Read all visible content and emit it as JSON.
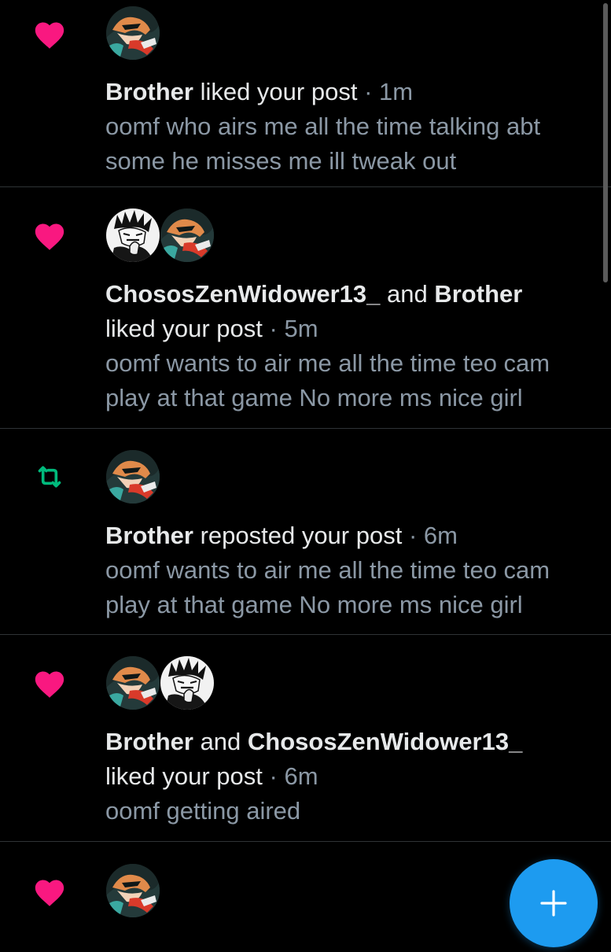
{
  "colors": {
    "background": "#000000",
    "heart": "#f91880",
    "repost": "#00ba7c",
    "fab": "#1d9bf0",
    "muted_text": "#8b98a5",
    "divider": "#2f3336"
  },
  "notifications": [
    {
      "type": "like",
      "icon": "heart-icon",
      "avatars": [
        "brother-avatar"
      ],
      "user1": "Brother",
      "connector": "",
      "user2": "",
      "action": " liked your post",
      "separator": " · ",
      "time": "1m",
      "snippet_line1": "oomf who airs me all the time talking abt",
      "snippet_line2": "some he misses me ill tweak out"
    },
    {
      "type": "like",
      "icon": "heart-icon",
      "avatars": [
        "chososzenwidower13-avatar",
        "brother-avatar"
      ],
      "user1": "ChososZenWidower13_",
      "connector": " and ",
      "user2": "Brother",
      "action": "liked your post",
      "separator": " · ",
      "time": "5m",
      "snippet_line1": "oomf wants to air me all the time teo cam",
      "snippet_line2": "play at that game No more ms nice girl"
    },
    {
      "type": "repost",
      "icon": "repost-icon",
      "avatars": [
        "brother-avatar"
      ],
      "user1": "Brother",
      "connector": "",
      "user2": "",
      "action": " reposted your post",
      "separator": " · ",
      "time": "6m",
      "snippet_line1": "oomf wants to air me all the time teo cam",
      "snippet_line2": "play at that game No more ms nice girl"
    },
    {
      "type": "like",
      "icon": "heart-icon",
      "avatars": [
        "brother-avatar",
        "chososzenwidower13-avatar"
      ],
      "user1": "Brother",
      "connector": " and ",
      "user2": "ChososZenWidower13_",
      "action": "liked your post",
      "separator": " · ",
      "time": "6m",
      "snippet_line1": "oomf getting aired",
      "snippet_line2": ""
    },
    {
      "type": "like",
      "icon": "heart-icon",
      "avatars": [
        "brother-avatar"
      ]
    }
  ],
  "fab": {
    "icon": "plus-icon",
    "label": "+"
  }
}
